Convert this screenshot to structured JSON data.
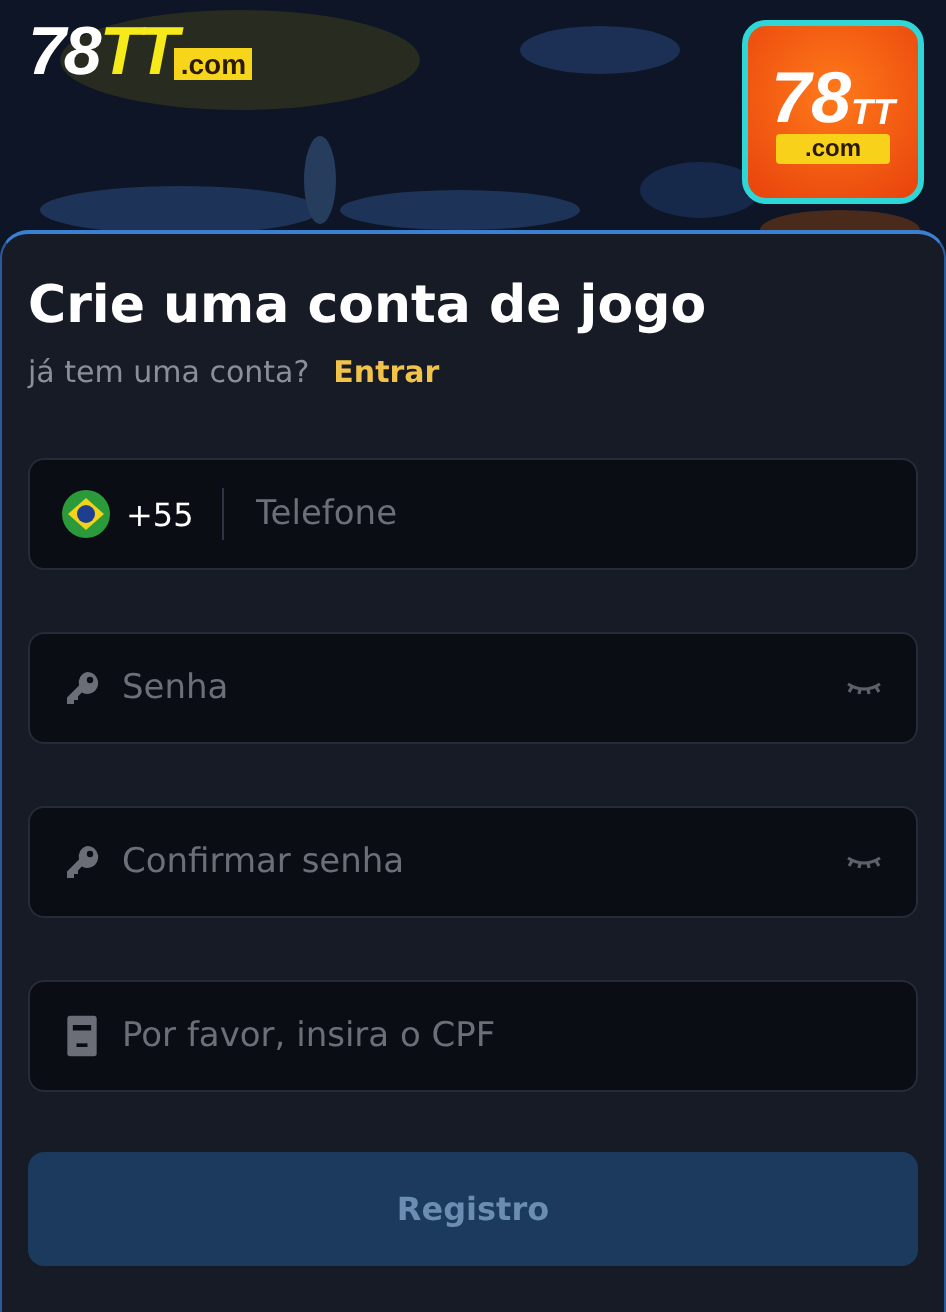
{
  "header": {
    "logo": {
      "number": "78",
      "letters": "TT",
      "domain": ".com"
    },
    "app_icon": {
      "number": "78",
      "letters": "TT",
      "domain": ".com"
    }
  },
  "form": {
    "title": "Crie uma conta de jogo",
    "prompt": "já tem uma conta?",
    "login_link": "Entrar",
    "fields": [
      {
        "kind": "phone",
        "country_code": "+55",
        "placeholder": "Telefone"
      },
      {
        "kind": "password",
        "placeholder": "Senha"
      },
      {
        "kind": "password",
        "placeholder": "Confirmar senha"
      },
      {
        "kind": "cpf",
        "placeholder": "Por favor, insira o CPF"
      }
    ],
    "submit": {
      "label": "Registro",
      "disabled": true
    }
  }
}
